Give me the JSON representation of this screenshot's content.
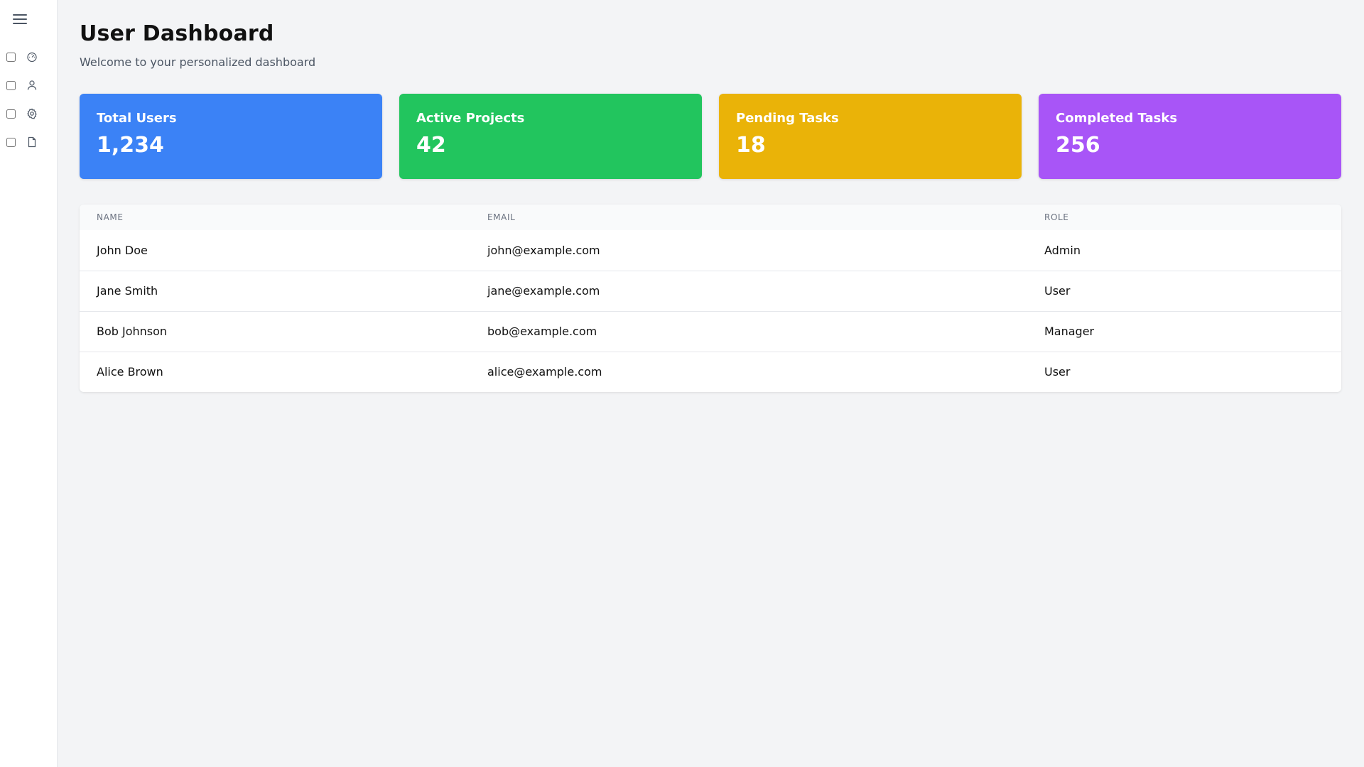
{
  "page": {
    "title": "User Dashboard",
    "subtitle": "Welcome to your personalized dashboard"
  },
  "sidebar": {
    "menu_icon": "hamburger-menu-icon",
    "items": [
      {
        "icon": "dashboard-gauge-icon",
        "checked": false
      },
      {
        "icon": "user-icon",
        "checked": false
      },
      {
        "icon": "gear-icon",
        "checked": false
      },
      {
        "icon": "document-icon",
        "checked": false
      }
    ]
  },
  "cards": [
    {
      "label": "Total Users",
      "value": "1,234",
      "color": "#3b82f6"
    },
    {
      "label": "Active Projects",
      "value": "42",
      "color": "#22c55e"
    },
    {
      "label": "Pending Tasks",
      "value": "18",
      "color": "#eab308"
    },
    {
      "label": "Completed Tasks",
      "value": "256",
      "color": "#a855f7"
    }
  ],
  "table": {
    "headers": [
      "NAME",
      "EMAIL",
      "ROLE"
    ],
    "rows": [
      [
        "John Doe",
        "john@example.com",
        "Admin"
      ],
      [
        "Jane Smith",
        "jane@example.com",
        "User"
      ],
      [
        "Bob Johnson",
        "bob@example.com",
        "Manager"
      ],
      [
        "Alice Brown",
        "alice@example.com",
        "User"
      ]
    ]
  }
}
